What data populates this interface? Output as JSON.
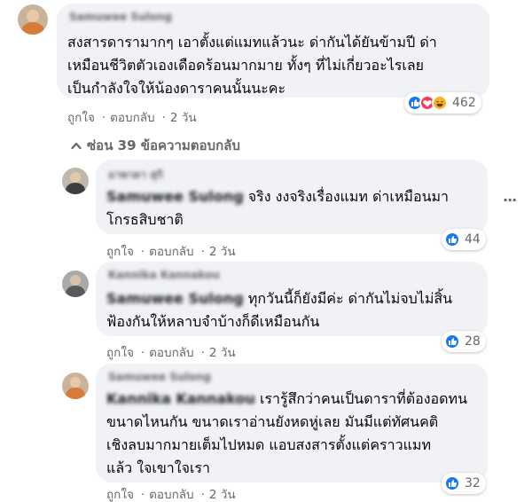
{
  "comment": {
    "author": "Samuwee Sulong",
    "text_lines": [
      "สงสารดารามากๆ เอาตั้งแต่แมทแล้วนะ ด่ากันได้ยันข้ามปี ด่า",
      "เหมือนชีวิตตัวเองเดือดร้อนมากมาย ทั้งๆ ที่ไม่เกี่ยวอะไรเลย",
      "เป็นกำลังใจให้น้องดาราคนนั้นนะคะ"
    ],
    "like_label": "ถูกใจ",
    "reply_label": "ตอบกลับ",
    "time": "2 วัน",
    "reaction_count": "462"
  },
  "hide_replies_label": "ซ่อน 39 ข้อความตอบกลับ",
  "replies": [
    {
      "author": "อาพาดา สุกิ",
      "tag": "Samuwee Sulong",
      "text_lines": [
        "จริง งงจริงเรื่องแมท ด่าเหมือนมา",
        "โกรธสิบชาติ"
      ],
      "like_label": "ถูกใจ",
      "reply_label": "ตอบกลับ",
      "time": "2 วัน",
      "reaction_count": "44"
    },
    {
      "author": "Kannika Kannakou",
      "tag": "Samuwee Sulong",
      "text_lines": [
        "ทุกวันนี้ก็ยังมีค่ะ ด่ากันไม่จบไม่สิ้น",
        "ฟ้องกันให้หลาบจำบ้างก็ดีเหมือนกัน"
      ],
      "like_label": "ถูกใจ",
      "reply_label": "ตอบกลับ",
      "time": "2 วัน",
      "reaction_count": "28"
    },
    {
      "author": "Samuwee Sulong",
      "tag": "Kannika Kannakou",
      "text_lines": [
        "เรารู้สึกว่าคนเป็นดาราที่ต้องอดทน",
        "ขนาดไหนกัน ขนาดเราอ่านยังหดหู่เลย มันมีแต่ทัศนคติ",
        "เชิงลบมากมายเต็มไปหมด แอบสงสารตั้งแต่คราวแมท",
        "แล้ว ใจเขาใจเรา"
      ],
      "like_label": "ถูกใจ",
      "reply_label": "ตอบกลับ",
      "time": "2 วัน",
      "reaction_count": "32"
    }
  ],
  "colors": {
    "bubble": "#f0f2f5",
    "like_blue": "#1877f2",
    "love_red": "#f33e58",
    "haha_yellow": "#f7b125",
    "meta_grey": "#65676b"
  }
}
